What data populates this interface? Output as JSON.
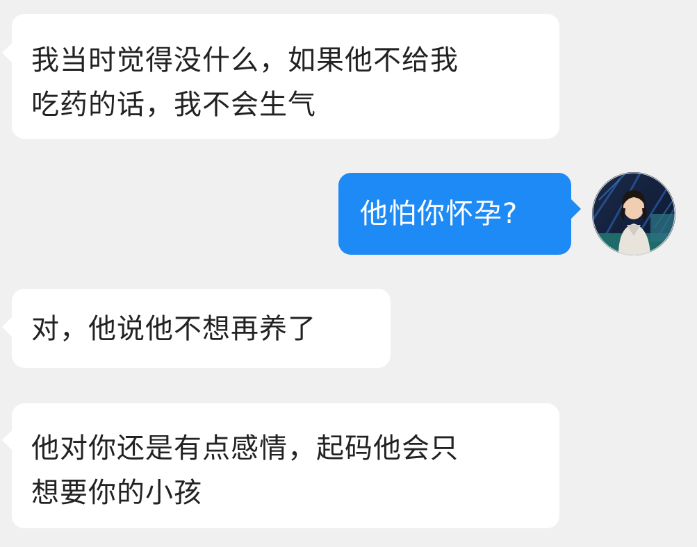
{
  "messages": [
    {
      "side": "incoming",
      "lines": [
        "我当时觉得没什么，如果他不给我",
        "吃药的话，我不会生气"
      ]
    },
    {
      "side": "outgoing",
      "lines": [
        "他怕你怀孕?"
      ]
    },
    {
      "side": "incoming",
      "lines": [
        "对，他说他不想再养了"
      ]
    },
    {
      "side": "incoming",
      "lines": [
        "他对你还是有点感情，起码他会只",
        "想要你的小孩"
      ]
    }
  ],
  "avatar": {
    "icon": "user-avatar-photo"
  },
  "colors": {
    "background": "#f0f0f0",
    "incoming_bubble": "#ffffff",
    "outgoing_bubble": "#1e8af6",
    "incoming_text": "#222222",
    "outgoing_text": "#ffffff"
  }
}
